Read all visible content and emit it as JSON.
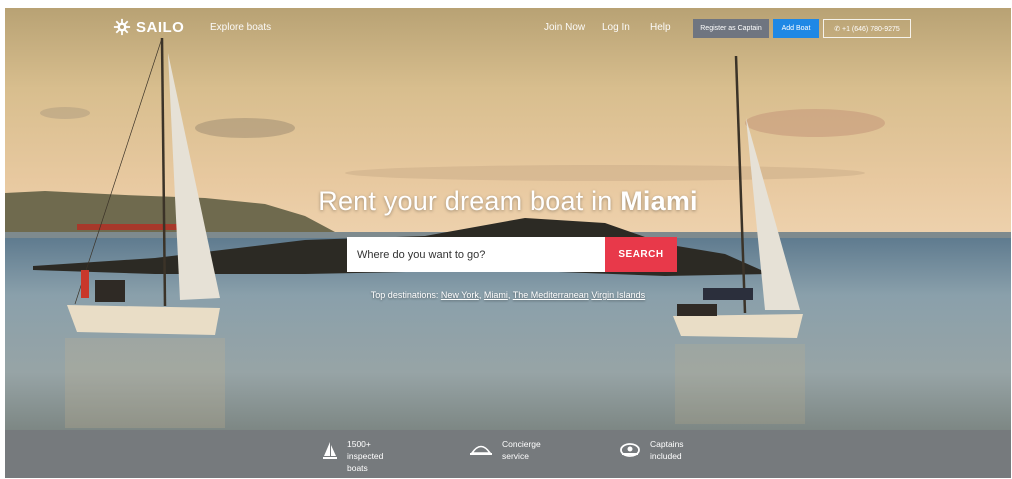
{
  "nav": {
    "logo": "SAILO",
    "explore": "Explore boats",
    "join": "Join Now",
    "login": "Log In",
    "help": "Help",
    "register_captain": "Register as Captain",
    "add_boat": "Add Boat",
    "phone": "+1 (646) 780-9275"
  },
  "hero": {
    "title_prefix": "Rent your dream boat in",
    "title_city": "Miami"
  },
  "search": {
    "placeholder": "Where do you want to go?",
    "button": "SEARCH"
  },
  "destinations": {
    "label": "Top destinations:",
    "items": [
      "New York",
      "Miami",
      "The Mediterranean",
      "Virgin Islands"
    ]
  },
  "features": [
    {
      "line1": "1500+",
      "line2": "inspected",
      "line3": "boats",
      "icon": "sailboat-icon"
    },
    {
      "line1": "Concierge",
      "line2": "service",
      "icon": "concierge-icon"
    },
    {
      "line1": "Captains",
      "line2": "included",
      "icon": "captain-hat-icon"
    }
  ],
  "colors": {
    "search_button": "#e8394a",
    "add_boat": "#1e88e5",
    "register": "#6f7580"
  }
}
